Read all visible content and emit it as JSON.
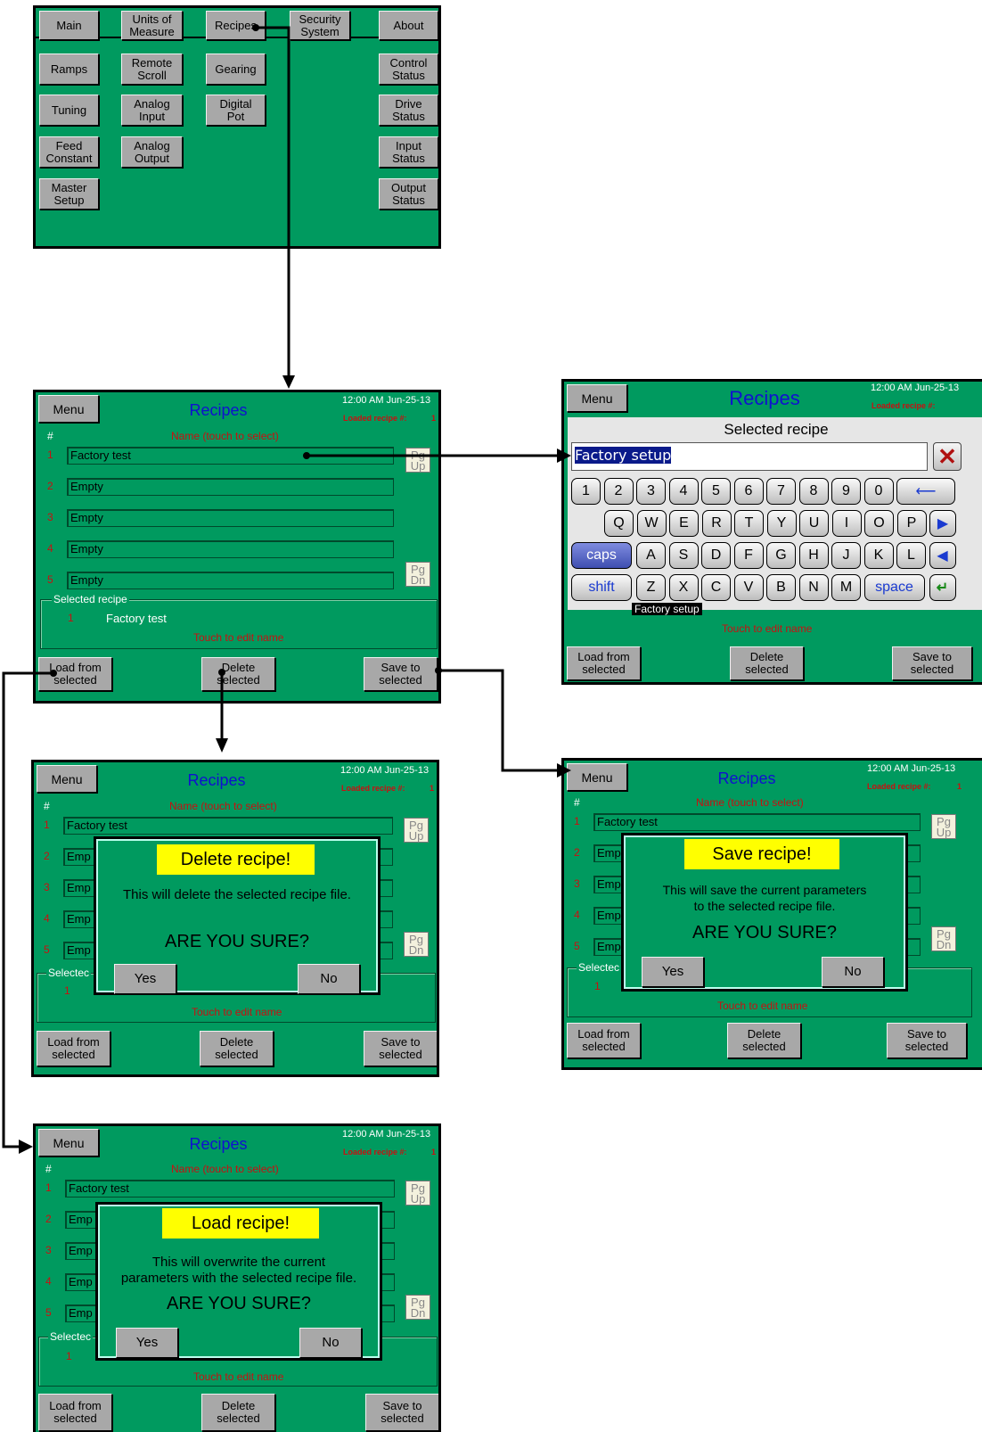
{
  "main_menu": {
    "tabs": [
      "Main",
      "Units of\nMeasure",
      "Recipes",
      "Security\nSystem",
      "About"
    ],
    "buttons": {
      "ramps": "Ramps",
      "remote_scroll": "Remote\nScroll",
      "gearing": "Gearing",
      "control_status": "Control\nStatus",
      "tuning": "Tuning",
      "analog_input": "Analog\nInput",
      "digital_pot": "Digital\nPot",
      "drive_status": "Drive\nStatus",
      "feed_constant": "Feed\nConstant",
      "analog_output": "Analog\nOutput",
      "input_status": "Input\nStatus",
      "master_setup": "Master\nSetup",
      "output_status": "Output\nStatus"
    }
  },
  "recipes_screen": {
    "menu": "Menu",
    "title": "Recipes",
    "clock": "12:00 AM Jun-25-13",
    "loaded_label": "Loaded recipe #:",
    "loaded_value": "1",
    "col_num": "#",
    "col_name": "Name (touch to select)",
    "rows": [
      {
        "n": "1",
        "name": "Factory test"
      },
      {
        "n": "2",
        "name": "Empty"
      },
      {
        "n": "3",
        "name": "Empty"
      },
      {
        "n": "4",
        "name": "Empty"
      },
      {
        "n": "5",
        "name": "Empty"
      }
    ],
    "pg_up": "Pg\nUp",
    "pg_dn": "Pg\nDn",
    "selected_label": "Selected recipe",
    "selected_num": "1",
    "selected_name": "Factory test",
    "touch_hint": "Touch to edit name",
    "load_btn": "Load from\nselected",
    "delete_btn": "Delete\nselected",
    "save_btn": "Save to\nselected",
    "row_trunc": "Emp",
    "selected_trunc": "Selectec"
  },
  "keyboard_screen": {
    "title": "Recipes",
    "clock": "12:00 AM Jun-25-13",
    "loaded_label": "Loaded recipe #:",
    "dialog_title": "Selected recipe",
    "input_value": "Factory setup",
    "under_text": "Factory setup",
    "row1": [
      "1",
      "2",
      "3",
      "4",
      "5",
      "6",
      "7",
      "8",
      "9",
      "0"
    ],
    "row2": [
      "Q",
      "W",
      "E",
      "R",
      "T",
      "Y",
      "U",
      "I",
      "O",
      "P"
    ],
    "row3": [
      "A",
      "S",
      "D",
      "F",
      "G",
      "H",
      "J",
      "K",
      "L"
    ],
    "row4": [
      "Z",
      "X",
      "C",
      "V",
      "B",
      "N",
      "M"
    ],
    "caps": "caps",
    "shift": "shift",
    "space": "space",
    "icons": {
      "clear": "close-x-icon",
      "backspace": "arrow-left-icon",
      "right": "triangle-right-icon",
      "left": "triangle-left-icon",
      "enter": "enter-icon"
    }
  },
  "delete_dialog": {
    "title": "Delete recipe!",
    "message": "This will delete the selected recipe file.",
    "sure": "ARE YOU SURE?",
    "yes": "Yes",
    "no": "No"
  },
  "save_dialog": {
    "title": "Save recipe!",
    "message": "This will save the current parameters\nto the selected recipe file.",
    "sure": "ARE YOU SURE?",
    "yes": "Yes",
    "no": "No"
  },
  "load_dialog": {
    "title": "Load recipe!",
    "message": "This will overwrite the current\nparameters with the selected recipe file.",
    "sure": "ARE YOU SURE?",
    "yes": "Yes",
    "no": "No"
  }
}
